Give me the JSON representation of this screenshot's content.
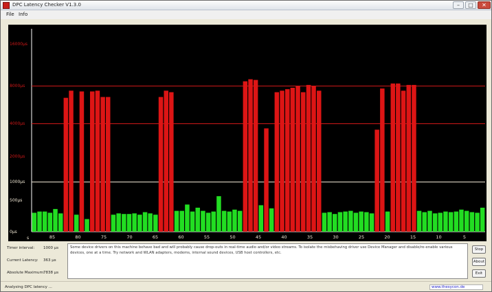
{
  "window": {
    "title": "DPC Latency Checker V1.3.0",
    "controls": {
      "minimize": "–",
      "maximize": "□",
      "close": "✕"
    }
  },
  "menu": [
    "File",
    "Info"
  ],
  "chart_data": {
    "type": "bar",
    "y_tick_labels": [
      "16000µs",
      "8000µs",
      "4000µs",
      "2000µs",
      "1000µs",
      "500µs",
      "0µs"
    ],
    "x_tick_labels": [
      "85",
      "80",
      "75",
      "70",
      "65",
      "60",
      "55",
      "50",
      "45",
      "40",
      "35",
      "30",
      "25",
      "20",
      "15",
      "10",
      "5"
    ],
    "x_corner_label": "s",
    "x_range_seconds": [
      89,
      1
    ],
    "threshold_lines_us": [
      1000,
      4000,
      8000
    ],
    "threshold_colors": [
      "#f2e9d6",
      "#d01818",
      "#d01818"
    ],
    "bar_colors": {
      "ok": "#22dd22",
      "high": "#dd1515"
    },
    "bar_threshold_us": 2000,
    "values_us": [
      300,
      320,
      320,
      300,
      360,
      290,
      6400,
      7300,
      270,
      7200,
      200,
      7200,
      7300,
      6500,
      6500,
      270,
      290,
      280,
      280,
      290,
      270,
      310,
      290,
      270,
      6500,
      7300,
      7100,
      330,
      330,
      430,
      320,
      380,
      330,
      300,
      320,
      580,
      330,
      320,
      350,
      330,
      8600,
      8900,
      8800,
      420,
      3600,
      370,
      7100,
      7300,
      7500,
      7700,
      7900,
      7100,
      8100,
      7900,
      7300,
      300,
      310,
      280,
      310,
      320,
      330,
      300,
      320,
      310,
      290,
      3500,
      7600,
      320,
      8300,
      8300,
      7300,
      8100,
      8100,
      330,
      310,
      330,
      290,
      300,
      320,
      310,
      320,
      350,
      330,
      310,
      300,
      380
    ]
  },
  "stats": {
    "current_interval_label": "Timer interval:",
    "current_interval_value": "1000 µs",
    "current_latency_label": "Current Latency:",
    "current_latency_value": "363 µs",
    "absolute_max_label": "Absolute Maximum:",
    "absolute_max_value": "7838 µs"
  },
  "message": "Some device drivers on this machine behave bad and will probably cause drop-outs in real-time audio and/or video streams. To isolate the misbehaving driver use Device Manager and disable/re-enable various devices, one at a time. Try network and WLAN adapters, modems, internal sound devices, USB host controllers, etc.",
  "buttons": {
    "stop": "Stop",
    "about": "About",
    "exit": "Exit"
  },
  "status": {
    "left": "Analysing DPC latency ...",
    "right": "www.thesycon.de"
  }
}
